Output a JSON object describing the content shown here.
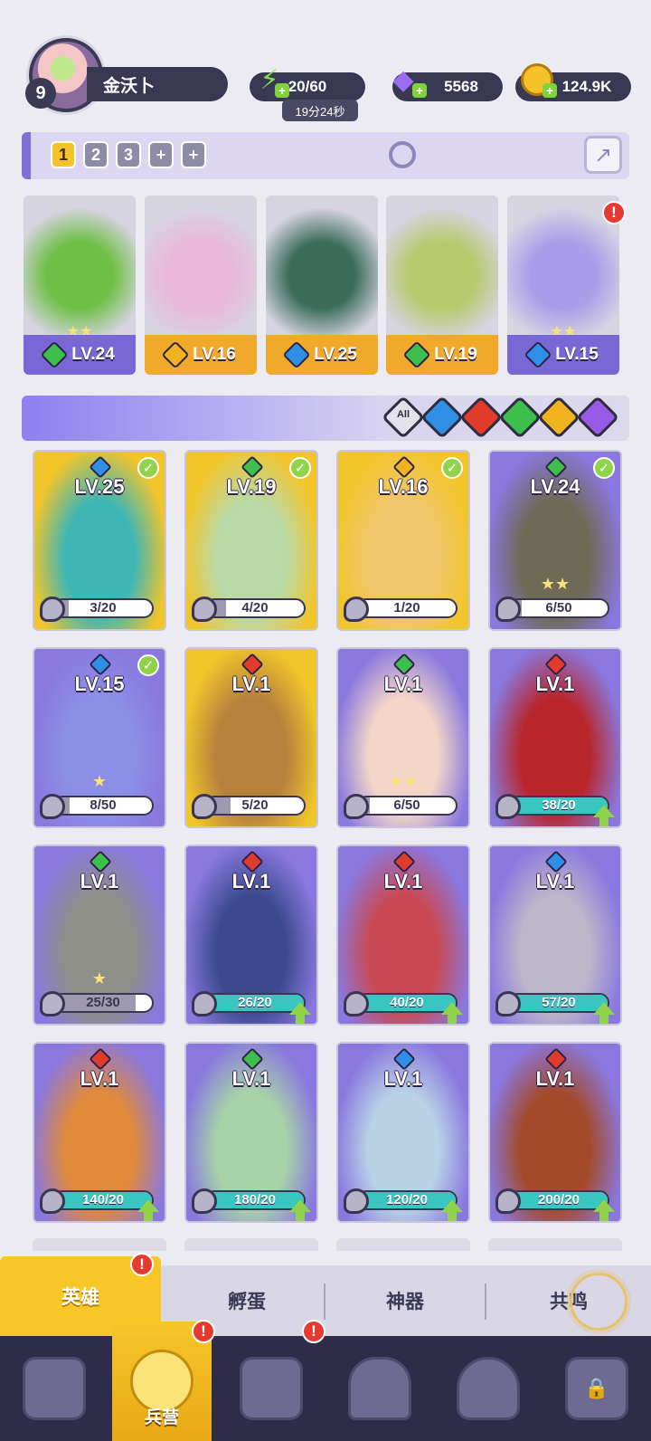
{
  "player": {
    "level": "9",
    "name": "金沃卜"
  },
  "resources": {
    "energy": "20/60",
    "energy_timer": "19分24秒",
    "gems": "5568",
    "gold": "124.9K"
  },
  "team_tabs": [
    "1",
    "2",
    "3",
    "+",
    "+"
  ],
  "team_slots": [
    {
      "level": "LV.24",
      "element": "green",
      "stars": "★★",
      "bg": "#7a67d6",
      "art": "#6fbf46"
    },
    {
      "level": "LV.16",
      "element": "gold",
      "stars": "",
      "bg": "#f0a92b",
      "art": "#e9b7d8"
    },
    {
      "level": "LV.25",
      "element": "blue",
      "stars": "",
      "bg": "#f0a92b",
      "art": "#3b6d5a"
    },
    {
      "level": "LV.19",
      "element": "green",
      "stars": "",
      "bg": "#f0a92b",
      "art": "#b7c96c"
    },
    {
      "level": "LV.15",
      "element": "blue",
      "stars": "★★",
      "bg": "#7a67d6",
      "art": "#a99de9"
    }
  ],
  "filters": [
    "All",
    "water",
    "fire",
    "nature",
    "light",
    "dark"
  ],
  "filter_all_label": "All",
  "heroes": [
    {
      "level": "LV.25",
      "element": "blue",
      "progress": "3/20",
      "fill": 0.15,
      "owned": true,
      "bg": "#f2c52b",
      "art": "#3fb6b6",
      "stars": "",
      "upgrade": false
    },
    {
      "level": "LV.19",
      "element": "green",
      "progress": "4/20",
      "fill": 0.2,
      "owned": true,
      "bg": "#f2c52b",
      "art": "#b9d9a7",
      "stars": "",
      "upgrade": false
    },
    {
      "level": "LV.16",
      "element": "gold",
      "progress": "1/20",
      "fill": 0.05,
      "owned": true,
      "bg": "#f2c52b",
      "art": "#f0c66b",
      "stars": "",
      "upgrade": false
    },
    {
      "level": "LV.24",
      "element": "green",
      "progress": "6/50",
      "fill": 0.12,
      "owned": true,
      "bg": "#8a78df",
      "art": "#6e6a56",
      "stars": "★★",
      "upgrade": false
    },
    {
      "level": "LV.15",
      "element": "blue",
      "progress": "8/50",
      "fill": 0.16,
      "owned": true,
      "bg": "#8a78df",
      "art": "#8c8fe6",
      "stars": "★",
      "upgrade": false
    },
    {
      "level": "LV.1",
      "element": "red",
      "progress": "5/20",
      "fill": 0.25,
      "owned": false,
      "bg": "#f2c52b",
      "art": "#b5813c",
      "stars": "",
      "upgrade": false
    },
    {
      "level": "LV.1",
      "element": "green",
      "progress": "6/50",
      "fill": 0.12,
      "owned": false,
      "bg": "#8a78df",
      "art": "#f3d6c8",
      "stars": "★★",
      "upgrade": false
    },
    {
      "level": "LV.1",
      "element": "red",
      "progress": "38/20",
      "fill": 1.0,
      "owned": false,
      "bg": "#8a78df",
      "art": "#b8262b",
      "stars": "",
      "upgrade": true
    },
    {
      "level": "LV.1",
      "element": "green",
      "progress": "25/30",
      "fill": 0.83,
      "owned": false,
      "bg": "#8a78df",
      "art": "#8f8f8a",
      "stars": "★",
      "upgrade": false
    },
    {
      "level": "LV.1",
      "element": "red",
      "progress": "26/20",
      "fill": 1.0,
      "owned": false,
      "bg": "#8a78df",
      "art": "#3b4a8e",
      "stars": "",
      "upgrade": true
    },
    {
      "level": "LV.1",
      "element": "red",
      "progress": "40/20",
      "fill": 1.0,
      "owned": false,
      "bg": "#8a78df",
      "art": "#c94a55",
      "stars": "",
      "upgrade": true
    },
    {
      "level": "LV.1",
      "element": "blue",
      "progress": "57/20",
      "fill": 1.0,
      "owned": false,
      "bg": "#8a78df",
      "art": "#bdb6c9",
      "stars": "",
      "upgrade": true
    },
    {
      "level": "LV.1",
      "element": "red",
      "progress": "140/20",
      "fill": 1.0,
      "owned": false,
      "bg": "#8a78df",
      "art": "#e08a3c",
      "stars": "",
      "upgrade": true
    },
    {
      "level": "LV.1",
      "element": "green",
      "progress": "180/20",
      "fill": 1.0,
      "owned": false,
      "bg": "#8a78df",
      "art": "#a7d3a8",
      "stars": "",
      "upgrade": true
    },
    {
      "level": "LV.1",
      "element": "blue",
      "progress": "120/20",
      "fill": 1.0,
      "owned": false,
      "bg": "#8a78df",
      "art": "#b9d2e6",
      "stars": "",
      "upgrade": true
    },
    {
      "level": "LV.1",
      "element": "red",
      "progress": "200/20",
      "fill": 1.0,
      "owned": false,
      "bg": "#8a78df",
      "art": "#a34a2a",
      "stars": "",
      "upgrade": true
    }
  ],
  "categories": {
    "heroes": "英雄",
    "hatch": "孵蛋",
    "artifacts": "神器",
    "resonance": "共鸣"
  },
  "alerts": {
    "category_heroes": "!",
    "nav_barracks": "!",
    "nav_map": "!",
    "team_slot_5": "!"
  },
  "nav": {
    "cards_icon": "cards-icon",
    "barracks_label": "兵营",
    "map_icon": "map-icon",
    "castle_icon": "castle-icon",
    "guild_icon": "mushroom-icon",
    "locked_icon": "lock-icon"
  },
  "colors": {
    "water": "#2f8fe6",
    "fire": "#e03b2b",
    "nature": "#3cbf4b",
    "light": "#f0b21e",
    "dark": "#9a5ae8",
    "accent": "#f7c727"
  }
}
